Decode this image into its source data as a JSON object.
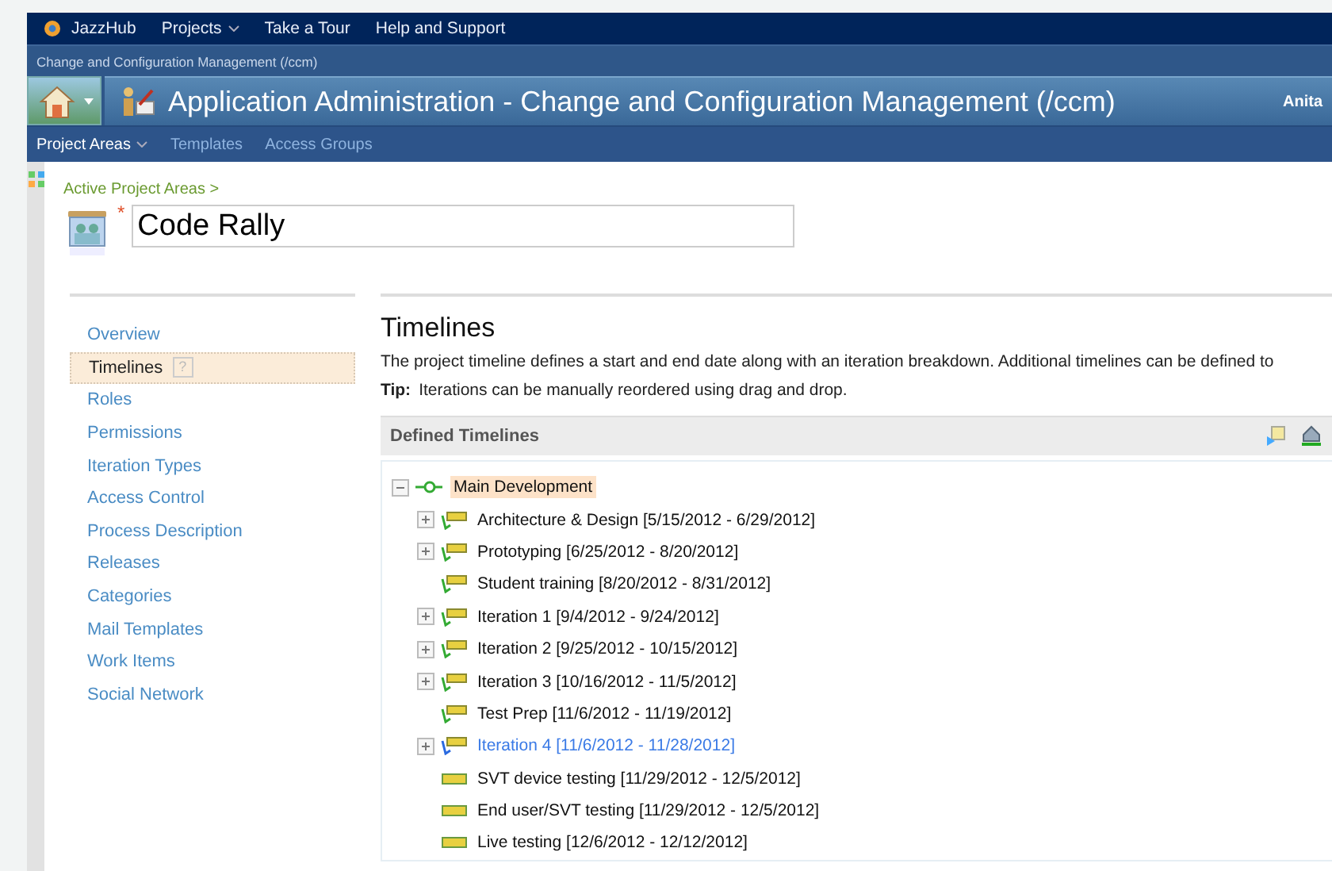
{
  "top_nav": {
    "brand": "JazzHub",
    "items": [
      {
        "label": "Projects",
        "dropdown": true
      },
      {
        "label": "Take a Tour",
        "dropdown": false
      },
      {
        "label": "Help and Support",
        "dropdown": false
      }
    ]
  },
  "breadcrumb_bar": "Change and Configuration Management (/ccm)",
  "title_bar": {
    "title": "Application Administration - Change and Configuration Management (/ccm)",
    "user": "Anita"
  },
  "sub_nav": [
    {
      "label": "Project Areas",
      "selected": true
    },
    {
      "label": "Templates",
      "selected": false
    },
    {
      "label": "Access Groups",
      "selected": false
    }
  ],
  "breadcrumb": "Active Project Areas >",
  "project_name": {
    "required_mark": "*",
    "value": "Code Rally"
  },
  "sidebar": {
    "items": [
      {
        "label": "Overview",
        "selected": false
      },
      {
        "label": "Timelines",
        "selected": true,
        "help": "?"
      },
      {
        "label": "Roles",
        "selected": false
      },
      {
        "label": "Permissions",
        "selected": false
      },
      {
        "label": "Iteration Types",
        "selected": false
      },
      {
        "label": "Access Control",
        "selected": false
      },
      {
        "label": "Process Description",
        "selected": false
      },
      {
        "label": "Releases",
        "selected": false
      },
      {
        "label": "Categories",
        "selected": false
      },
      {
        "label": "Mail Templates",
        "selected": false
      },
      {
        "label": "Work Items",
        "selected": false
      },
      {
        "label": "Social Network",
        "selected": false
      }
    ]
  },
  "section": {
    "title": "Timelines",
    "description": "The project timeline defines a start and end date along with an iteration breakdown. Additional timelines can be defined to",
    "tip_label": "Tip:",
    "tip": "Iterations can be manually reordered using drag and drop."
  },
  "defined_timelines": {
    "title": "Defined Timelines",
    "tree": {
      "label": "Main Development",
      "selected": true,
      "expanded": true,
      "children": [
        {
          "label": "Architecture & Design [5/15/2012 - 6/29/2012]",
          "kind": "iteration",
          "expandable": true,
          "current": false
        },
        {
          "label": "Prototyping [6/25/2012 - 8/20/2012]",
          "kind": "iteration",
          "expandable": true,
          "current": false
        },
        {
          "label": "Student training [8/20/2012 - 8/31/2012]",
          "kind": "iteration",
          "expandable": false,
          "current": false
        },
        {
          "label": "Iteration 1 [9/4/2012 - 9/24/2012]",
          "kind": "iteration",
          "expandable": true,
          "current": false
        },
        {
          "label": "Iteration 2 [9/25/2012 - 10/15/2012]",
          "kind": "iteration",
          "expandable": true,
          "current": false
        },
        {
          "label": "Iteration 3 [10/16/2012 - 11/5/2012]",
          "kind": "iteration",
          "expandable": true,
          "current": false
        },
        {
          "label": "Test Prep [11/6/2012 - 11/19/2012]",
          "kind": "iteration",
          "expandable": false,
          "current": false
        },
        {
          "label": "Iteration 4 [11/6/2012 - 11/28/2012]",
          "kind": "iteration",
          "expandable": true,
          "current": true
        },
        {
          "label": "SVT device testing [11/29/2012 - 12/5/2012]",
          "kind": "phase",
          "expandable": false,
          "current": false
        },
        {
          "label": "End user/SVT testing [11/29/2012 - 12/5/2012]",
          "kind": "phase",
          "expandable": false,
          "current": false
        },
        {
          "label": "Live testing [12/6/2012 - 12/12/2012]",
          "kind": "phase",
          "expandable": false,
          "current": false
        }
      ]
    }
  }
}
